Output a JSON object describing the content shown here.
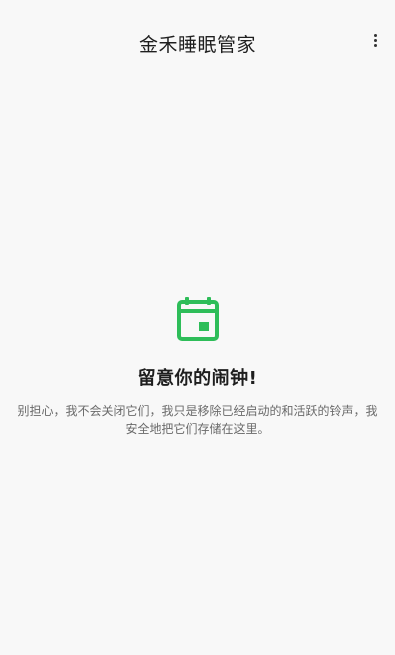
{
  "app_bar": {
    "title": "金禾睡眠管家",
    "menu_icon": "more-vert-icon"
  },
  "empty_state": {
    "icon": "calendar-icon",
    "icon_color": "#2ebd59",
    "title": "留意你的闹钟!",
    "description": "别担心，我不会关闭它们，我只是移除已经启动的和活跃的铃声，我安全地把它们存储在这里。"
  }
}
